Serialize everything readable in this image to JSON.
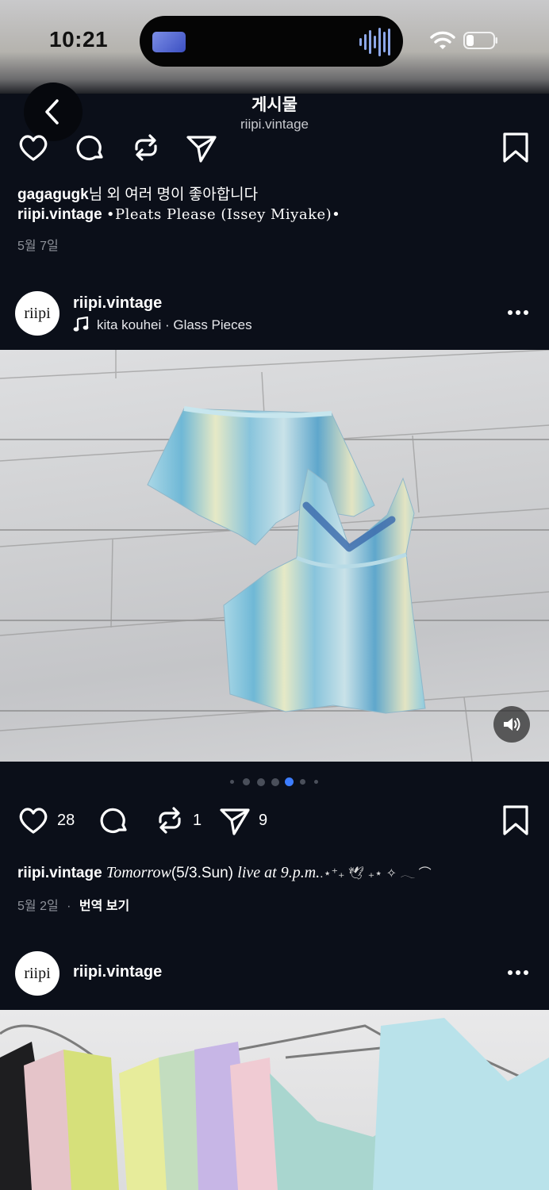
{
  "status_bar": {
    "time": "10:21"
  },
  "header": {
    "title": "게시물",
    "subtitle": "riipi.vintage"
  },
  "prev_post": {
    "likes_user": "gagagugk",
    "likes_suffix": "님 외 여러 명이 좋아합니다",
    "caption_user": "riipi.vintage",
    "caption_text": "•Pleats Please (Issey Miyake)•",
    "date": "5월 7일"
  },
  "post": {
    "avatar_text": "riipi",
    "username": "riipi.vintage",
    "music": "kita kouhei · Glass Pieces",
    "like_count": "28",
    "repost_count": "1",
    "share_count": "9",
    "caption_user": "riipi.vintage",
    "caption_text_a": "Tomorrow",
    "caption_text_b": "(5/3.Sun)",
    "caption_text_c": "live at 9.p.m.",
    "caption_deco": ".⋆⁺₊ 🕊 ₊⋆ ✧ 𓂃 ⌒",
    "date": "5월 2일",
    "translate_sep": "·",
    "translate_label": "번역 보기",
    "carousel": {
      "count": 7,
      "active_index": 4
    }
  },
  "next_post": {
    "avatar_text": "riipi",
    "username": "riipi.vintage"
  },
  "colors": {
    "background": "#0b0f19",
    "accent_dot": "#3d7dff",
    "muted_text": "#8e929a"
  }
}
